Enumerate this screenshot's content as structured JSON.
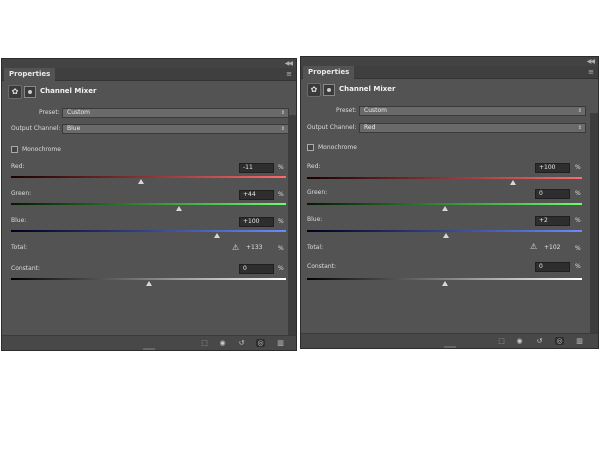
{
  "panels": [
    {
      "tab_label": "Properties",
      "title": "Channel Mixer",
      "preset_label": "Preset:",
      "preset_value": "Custom",
      "output_label": "Output Channel:",
      "output_value": "Blue",
      "monochrome_label": "Monochrome",
      "red_label": "Red:",
      "red_value": "-11",
      "green_label": "Green:",
      "green_value": "+44",
      "blue_label": "Blue:",
      "blue_value": "+100",
      "total_label": "Total:",
      "total_value": "+133",
      "constant_label": "Constant:",
      "constant_value": "0",
      "percent": "%",
      "sliders": {
        "red": -11,
        "green": 44,
        "blue": 100,
        "constant": 0
      },
      "icons": {
        "collapse": "double-arrow-icon",
        "menu": "panel-menu-icon",
        "adjustment": "adjustment-layer-icon",
        "mask": "mask-icon",
        "warning": "warning-triangle-icon",
        "clip": "clip-to-layer-icon",
        "view_previous": "view-previous-icon",
        "reset": "reset-icon",
        "visibility": "eye-icon",
        "delete": "trash-icon"
      }
    },
    {
      "tab_label": "Properties",
      "title": "Channel Mixer",
      "preset_label": "Preset:",
      "preset_value": "Custom",
      "output_label": "Output Channel:",
      "output_value": "Red",
      "monochrome_label": "Monochrome",
      "red_label": "Red:",
      "red_value": "+100",
      "green_label": "Green:",
      "green_value": "0",
      "blue_label": "Blue:",
      "blue_value": "+2",
      "total_label": "Total:",
      "total_value": "+102",
      "constant_label": "Constant:",
      "constant_value": "0",
      "percent": "%",
      "sliders": {
        "red": 100,
        "green": 0,
        "blue": 2,
        "constant": 0
      },
      "icons": {
        "collapse": "double-arrow-icon",
        "menu": "panel-menu-icon",
        "adjustment": "adjustment-layer-icon",
        "mask": "mask-icon",
        "warning": "warning-triangle-icon",
        "clip": "clip-to-layer-icon",
        "view_previous": "view-previous-icon",
        "reset": "reset-icon",
        "visibility": "eye-icon",
        "delete": "trash-icon"
      }
    }
  ],
  "colors": {
    "panel_bg": "#535353",
    "red_gradient": [
      "#1a0000",
      "#ff6a6a"
    ],
    "green_gradient": [
      "#001a00",
      "#6aff6a"
    ],
    "blue_gradient": [
      "#00001a",
      "#6a8aff"
    ],
    "constant_gradient": [
      "#000000",
      "#ffffff"
    ]
  }
}
